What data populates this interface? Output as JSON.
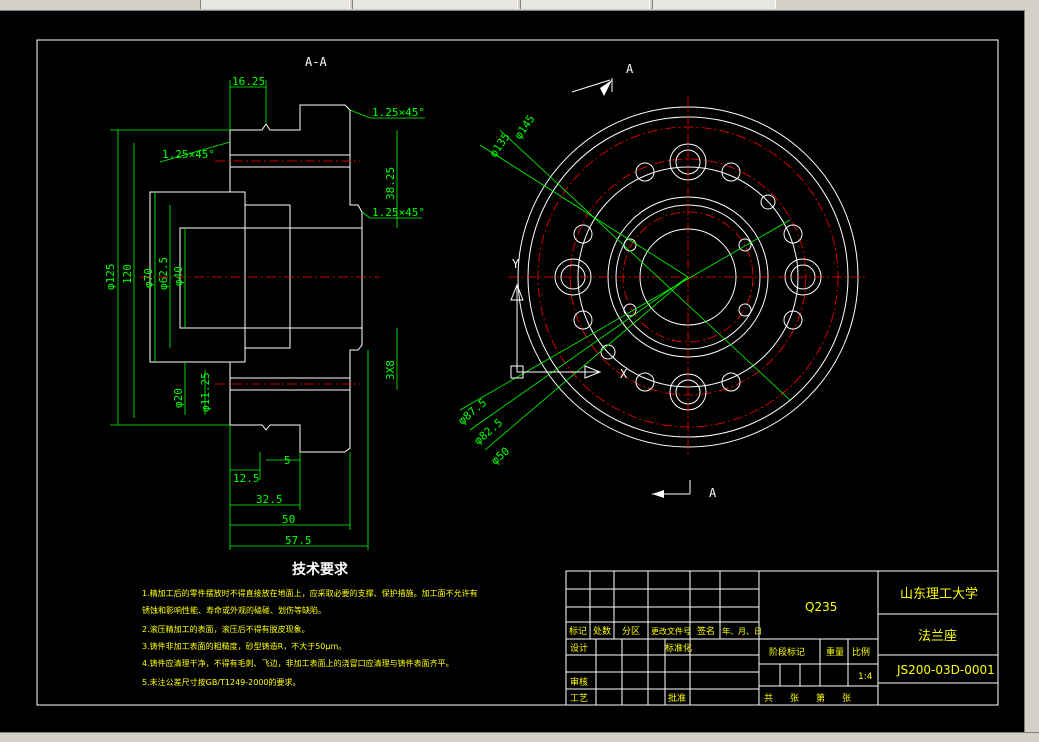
{
  "section_title": "A-A",
  "view_label": "A",
  "dimensions": {
    "d16_25": "16.25",
    "chamfer_top": "1.25×45°",
    "chamfer_left": "1.25×45°",
    "chamfer_mid": "1.25×45°",
    "d125": "φ125",
    "d120": "120",
    "d70": "φ70",
    "d62_5": "φ62.5",
    "d40": "φ40",
    "d38_25": "38.25",
    "d3x8": "3X8",
    "d20": "φ20",
    "d11_25": "φ11.25",
    "d12_5": "12.5",
    "d5": "5",
    "d32_5": "32.5",
    "d50": "50",
    "d57_5": "57.5",
    "c145": "φ145",
    "c135": "φ135",
    "c87_5": "φ87.5",
    "c82_5": "φ82.5",
    "c50": "φ50",
    "axis_y": "Y",
    "axis_x": "X"
  },
  "tech_title": "技术要求",
  "tech_notes": [
    "1.精加工后的零件摆放时不得直接放在地面上，应采取必要的支撑、保护措施。加工面不允许有",
    "锈蚀和影响性能、寿命或外观的磕碰、划伤等缺陷。",
    "2.滚压精加工的表面，滚压后不得有脱皮现象。",
    "3.铸件非加工表面的粗糙度，砂型铸造R，不大于50μm。",
    "4.铸件应清理干净，不得有毛刺、飞边，非加工表面上的浇冒口应清理与铸件表面齐平。",
    "5.未注公差尺寸按GB/T1249-2000的要求。"
  ],
  "title_block": {
    "material": "Q235",
    "university": "山东理工大学",
    "part_name": "法兰座",
    "drawing_no": "JS200-03D-0001",
    "h_mark": "标记",
    "h_count": "处数",
    "h_zone": "分区",
    "h_docno": "更改文件号",
    "h_sign": "签名",
    "h_date": "年、月、日",
    "design": "设计",
    "standard": "标准化",
    "stage": "阶段标记",
    "weight": "重量",
    "scale_label": "比例",
    "scale": "1:4",
    "review": "审核",
    "process": "工艺",
    "approve": "批准",
    "sheets_total": "共",
    "sheets_unit": "张",
    "sheet_no": "第",
    "sheet_unit": "张"
  }
}
